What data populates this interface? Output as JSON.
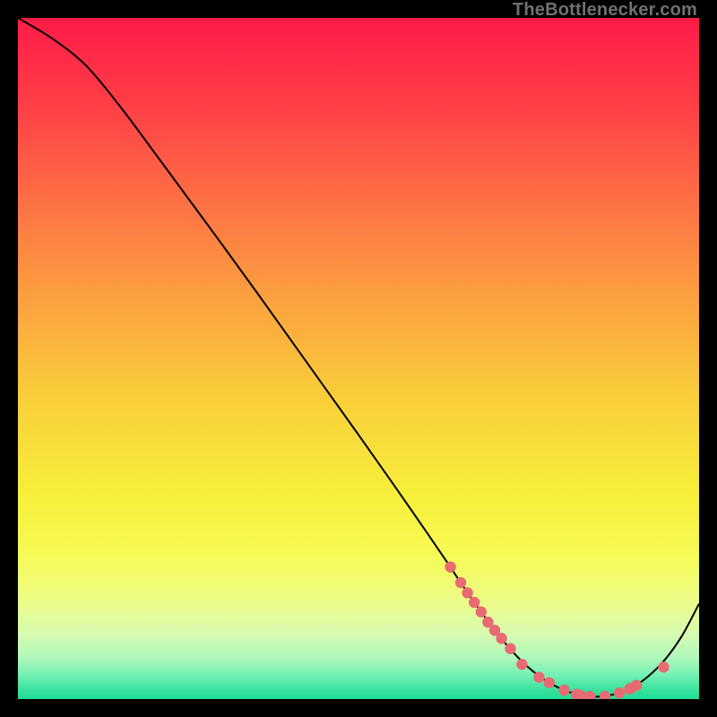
{
  "attribution": "TheBottlenecker.com",
  "colors": {
    "dot": "#e86a72",
    "line": "#000000",
    "bg_black": "#000000"
  },
  "chart_data": {
    "type": "line",
    "title": "",
    "xlabel": "",
    "ylabel": "",
    "xlim": [
      0,
      100
    ],
    "ylim": [
      0,
      100
    ],
    "grid": false,
    "legend": false,
    "series": [
      {
        "name": "bottleneck-curve",
        "x": [
          0,
          5,
          10,
          15,
          20,
          25,
          30,
          35,
          40,
          45,
          50,
          55,
          60,
          63,
          65,
          67.5,
          70,
          72.5,
          75,
          77.5,
          80,
          82.5,
          85,
          87.5,
          90,
          92.5,
          95,
          97.5,
          100
        ],
        "y": [
          100,
          97,
          93,
          87,
          80.3,
          73.5,
          66.7,
          59.8,
          52.8,
          45.8,
          38.8,
          31.7,
          24.5,
          20.1,
          17.1,
          13.5,
          10.1,
          7.1,
          4.6,
          2.7,
          1.4,
          0.6,
          0.35,
          0.7,
          1.6,
          3.3,
          5.8,
          9.3,
          14
        ]
      }
    ],
    "points": {
      "name": "highlighted-dots",
      "x": [
        63.5,
        65,
        66,
        67,
        68,
        69,
        70,
        71,
        72.3,
        74,
        76.5,
        78,
        80.2,
        82,
        82.5,
        84,
        86.2,
        88.3,
        89.8,
        90,
        90.8,
        94.8
      ],
      "y": [
        19.4,
        17.1,
        15.6,
        14.2,
        12.8,
        11.3,
        10.1,
        8.9,
        7.4,
        5.1,
        3.2,
        2.4,
        1.3,
        0.7,
        0.6,
        0.4,
        0.4,
        0.9,
        1.5,
        1.6,
        2.0,
        4.7
      ]
    },
    "background_gradient_stops": [
      {
        "offset": 0.0,
        "color": "#ff1b48"
      },
      {
        "offset": 0.14,
        "color": "#ff4246"
      },
      {
        "offset": 0.28,
        "color": "#fd7444"
      },
      {
        "offset": 0.42,
        "color": "#fba33f"
      },
      {
        "offset": 0.56,
        "color": "#f9cf3a"
      },
      {
        "offset": 0.7,
        "color": "#f7ef3a"
      },
      {
        "offset": 0.79,
        "color": "#f6fb55"
      },
      {
        "offset": 0.86,
        "color": "#ecfc8b"
      },
      {
        "offset": 0.905,
        "color": "#d7fbb1"
      },
      {
        "offset": 0.94,
        "color": "#aef8bb"
      },
      {
        "offset": 0.965,
        "color": "#74f0b3"
      },
      {
        "offset": 0.985,
        "color": "#3be39f"
      },
      {
        "offset": 1.0,
        "color": "#1fdc95"
      }
    ]
  }
}
